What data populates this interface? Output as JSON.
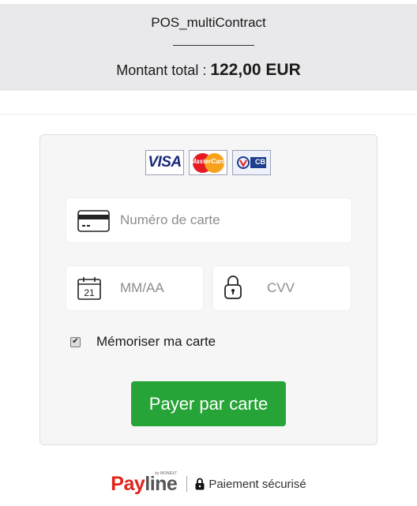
{
  "header": {
    "merchant": "POS_multiContract",
    "total_label": "Montant total : ",
    "total_amount": "122,00 EUR"
  },
  "card_brands": [
    {
      "name": "VISA",
      "icon": "visa-logo"
    },
    {
      "name": "MasterCard",
      "icon": "mastercard-logo"
    },
    {
      "name": "CB",
      "icon": "cb-logo"
    }
  ],
  "form": {
    "card_number": {
      "placeholder": "Numéro de carte",
      "value": "",
      "icon": "card-icon"
    },
    "expiry": {
      "placeholder": "MM/AA",
      "value": "",
      "icon": "calendar-icon",
      "calendar_day": "21"
    },
    "cvv": {
      "placeholder": "CVV",
      "value": "",
      "icon": "padlock-icon"
    },
    "remember": {
      "label": "Mémoriser ma carte",
      "checked": true
    },
    "submit_label": "Payer par carte"
  },
  "footer": {
    "brand_pay": "Pay",
    "brand_line": "line",
    "brand_sub": "by MONEXT",
    "secure_text": "Paiement sécurisé"
  },
  "colors": {
    "header_bg": "#e9e9eb",
    "button": "#27a438",
    "brand_red": "#e2231a"
  }
}
